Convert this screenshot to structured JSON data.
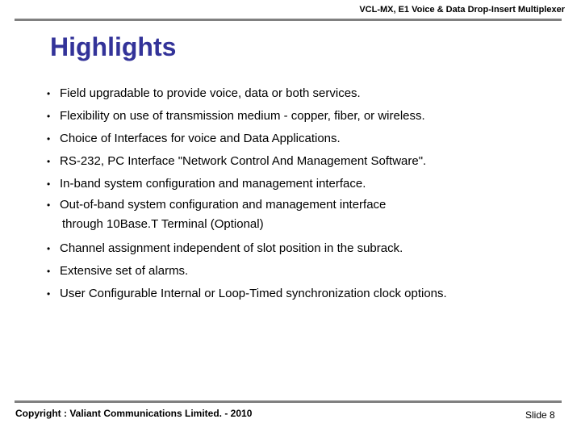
{
  "header": {
    "title": "VCL-MX, E1 Voice & Data Drop-Insert Multiplexer"
  },
  "slide": {
    "title": "Highlights",
    "bullet_glyph": "•",
    "bullets": [
      {
        "text": "Field upgradable to provide voice, data or both services."
      },
      {
        "text": "Flexibility on use of transmission medium - copper, fiber, or wireless."
      },
      {
        "text": "Choice of Interfaces for voice and Data Applications."
      },
      {
        "text": "RS-232, PC Interface \"Network Control And Management Software\"."
      },
      {
        "text": "In-band system configuration and management interface."
      },
      {
        "text": "Out-of-band system configuration and management interface",
        "continuation": "through 10Base.T Terminal (Optional)"
      },
      {
        "text": "Channel assignment independent of slot position in the subrack."
      },
      {
        "text": "Extensive set of alarms."
      },
      {
        "text": "User Configurable Internal or Loop-Timed synchronization clock options."
      }
    ]
  },
  "footer": {
    "copyright": "Copyright : Valiant Communications Limited. - 2010",
    "slide_number": "Slide 8"
  },
  "colors": {
    "title": "#333399",
    "rule": "#808080",
    "text": "#000000",
    "background": "#ffffff"
  }
}
